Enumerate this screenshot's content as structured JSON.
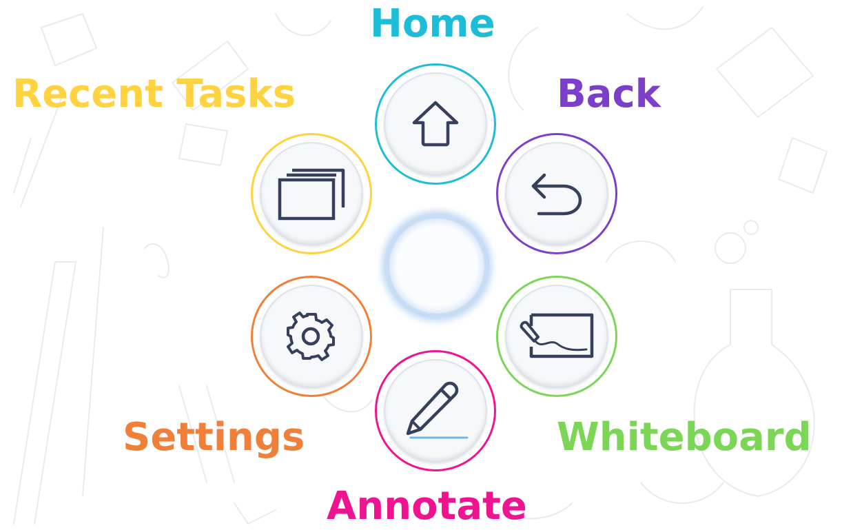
{
  "menu": {
    "items": [
      {
        "id": "home",
        "label": "Home",
        "color": "#1dbcd8",
        "icon": "home-icon"
      },
      {
        "id": "recent",
        "label": "Recent Tasks",
        "color": "#ffd23f",
        "icon": "windows-stack-icon"
      },
      {
        "id": "back",
        "label": "Back",
        "color": "#7b3fc9",
        "icon": "back-arrow-icon"
      },
      {
        "id": "settings",
        "label": "Settings",
        "color": "#f07f3a",
        "icon": "gear-icon"
      },
      {
        "id": "whiteboard",
        "label": "Whiteboard",
        "color": "#7cd656",
        "icon": "whiteboard-icon"
      },
      {
        "id": "annotate",
        "label": "Annotate",
        "color": "#ee1490",
        "icon": "pencil-icon"
      }
    ],
    "center": {
      "icon": "center-ring"
    }
  },
  "icon_color": "#36405a"
}
